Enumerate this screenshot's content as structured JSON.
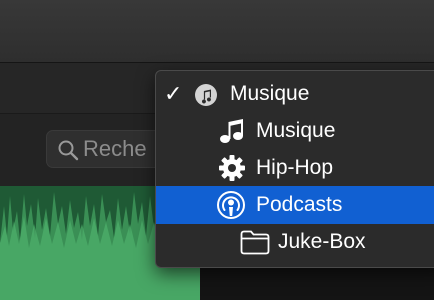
{
  "search": {
    "placeholder": "Reche"
  },
  "menu": {
    "items": [
      {
        "label": "Musique",
        "icon": "music-library-icon",
        "checked": true
      },
      {
        "label": "Musique",
        "icon": "music-note-icon"
      },
      {
        "label": "Hip-Hop",
        "icon": "gear-icon"
      },
      {
        "label": "Podcasts",
        "icon": "podcast-icon",
        "selected": true
      },
      {
        "label": "Juke-Box",
        "icon": "folder-icon"
      }
    ],
    "check_glyph": "✓"
  },
  "colors": {
    "selection": "#1160d2",
    "waveform": "#3a8f55",
    "menu_background": "#2b2b2b"
  }
}
